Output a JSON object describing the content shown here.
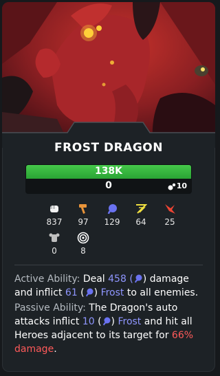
{
  "unit": {
    "name": "FROST DRAGON"
  },
  "bars": {
    "hp": "138K",
    "shield": "0",
    "ammo": "10"
  },
  "stats": {
    "attack": "837",
    "build": "97",
    "magic": "129",
    "speed": "64",
    "crit": "25",
    "armor": "0",
    "range": "8"
  },
  "active": {
    "label": "Active Ability:",
    "t1": " Deal ",
    "dmg": "458",
    "t2": " (",
    "t3": ") damage and inflict ",
    "frost": "61",
    "t4": " (",
    "t5": ") ",
    "frost_word": "Frost",
    "t6": " to all enemies."
  },
  "passive": {
    "label": "Passive Ability:",
    "t1": " The Dragon's auto attacks inflict ",
    "frost": "10",
    "t2": " (",
    "t3": ") ",
    "frost_word": "Frost",
    "t4": " and hit all Heroes adjacent to its target for ",
    "pct": "66% damage",
    "t5": "."
  },
  "colors": {
    "blue": "#8f96ff",
    "red": "#ff5a5a",
    "hp_green": "#3fbd44"
  }
}
